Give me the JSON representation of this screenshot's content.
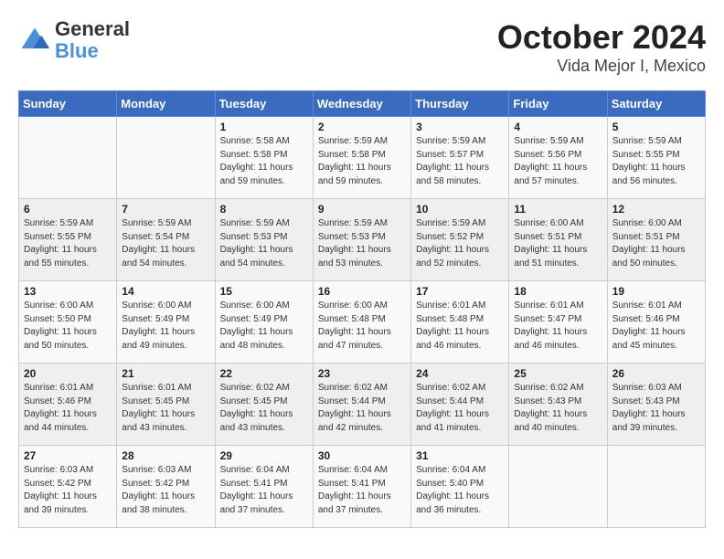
{
  "header": {
    "logo_general": "General",
    "logo_blue": "Blue",
    "title": "October 2024",
    "subtitle": "Vida Mejor I, Mexico"
  },
  "days_of_week": [
    "Sunday",
    "Monday",
    "Tuesday",
    "Wednesday",
    "Thursday",
    "Friday",
    "Saturday"
  ],
  "weeks": [
    [
      {
        "day": "",
        "info": ""
      },
      {
        "day": "",
        "info": ""
      },
      {
        "day": "1",
        "info": "Sunrise: 5:58 AM\nSunset: 5:58 PM\nDaylight: 11 hours and 59 minutes."
      },
      {
        "day": "2",
        "info": "Sunrise: 5:59 AM\nSunset: 5:58 PM\nDaylight: 11 hours and 59 minutes."
      },
      {
        "day": "3",
        "info": "Sunrise: 5:59 AM\nSunset: 5:57 PM\nDaylight: 11 hours and 58 minutes."
      },
      {
        "day": "4",
        "info": "Sunrise: 5:59 AM\nSunset: 5:56 PM\nDaylight: 11 hours and 57 minutes."
      },
      {
        "day": "5",
        "info": "Sunrise: 5:59 AM\nSunset: 5:55 PM\nDaylight: 11 hours and 56 minutes."
      }
    ],
    [
      {
        "day": "6",
        "info": "Sunrise: 5:59 AM\nSunset: 5:55 PM\nDaylight: 11 hours and 55 minutes."
      },
      {
        "day": "7",
        "info": "Sunrise: 5:59 AM\nSunset: 5:54 PM\nDaylight: 11 hours and 54 minutes."
      },
      {
        "day": "8",
        "info": "Sunrise: 5:59 AM\nSunset: 5:53 PM\nDaylight: 11 hours and 54 minutes."
      },
      {
        "day": "9",
        "info": "Sunrise: 5:59 AM\nSunset: 5:53 PM\nDaylight: 11 hours and 53 minutes."
      },
      {
        "day": "10",
        "info": "Sunrise: 5:59 AM\nSunset: 5:52 PM\nDaylight: 11 hours and 52 minutes."
      },
      {
        "day": "11",
        "info": "Sunrise: 6:00 AM\nSunset: 5:51 PM\nDaylight: 11 hours and 51 minutes."
      },
      {
        "day": "12",
        "info": "Sunrise: 6:00 AM\nSunset: 5:51 PM\nDaylight: 11 hours and 50 minutes."
      }
    ],
    [
      {
        "day": "13",
        "info": "Sunrise: 6:00 AM\nSunset: 5:50 PM\nDaylight: 11 hours and 50 minutes."
      },
      {
        "day": "14",
        "info": "Sunrise: 6:00 AM\nSunset: 5:49 PM\nDaylight: 11 hours and 49 minutes."
      },
      {
        "day": "15",
        "info": "Sunrise: 6:00 AM\nSunset: 5:49 PM\nDaylight: 11 hours and 48 minutes."
      },
      {
        "day": "16",
        "info": "Sunrise: 6:00 AM\nSunset: 5:48 PM\nDaylight: 11 hours and 47 minutes."
      },
      {
        "day": "17",
        "info": "Sunrise: 6:01 AM\nSunset: 5:48 PM\nDaylight: 11 hours and 46 minutes."
      },
      {
        "day": "18",
        "info": "Sunrise: 6:01 AM\nSunset: 5:47 PM\nDaylight: 11 hours and 46 minutes."
      },
      {
        "day": "19",
        "info": "Sunrise: 6:01 AM\nSunset: 5:46 PM\nDaylight: 11 hours and 45 minutes."
      }
    ],
    [
      {
        "day": "20",
        "info": "Sunrise: 6:01 AM\nSunset: 5:46 PM\nDaylight: 11 hours and 44 minutes."
      },
      {
        "day": "21",
        "info": "Sunrise: 6:01 AM\nSunset: 5:45 PM\nDaylight: 11 hours and 43 minutes."
      },
      {
        "day": "22",
        "info": "Sunrise: 6:02 AM\nSunset: 5:45 PM\nDaylight: 11 hours and 43 minutes."
      },
      {
        "day": "23",
        "info": "Sunrise: 6:02 AM\nSunset: 5:44 PM\nDaylight: 11 hours and 42 minutes."
      },
      {
        "day": "24",
        "info": "Sunrise: 6:02 AM\nSunset: 5:44 PM\nDaylight: 11 hours and 41 minutes."
      },
      {
        "day": "25",
        "info": "Sunrise: 6:02 AM\nSunset: 5:43 PM\nDaylight: 11 hours and 40 minutes."
      },
      {
        "day": "26",
        "info": "Sunrise: 6:03 AM\nSunset: 5:43 PM\nDaylight: 11 hours and 39 minutes."
      }
    ],
    [
      {
        "day": "27",
        "info": "Sunrise: 6:03 AM\nSunset: 5:42 PM\nDaylight: 11 hours and 39 minutes."
      },
      {
        "day": "28",
        "info": "Sunrise: 6:03 AM\nSunset: 5:42 PM\nDaylight: 11 hours and 38 minutes."
      },
      {
        "day": "29",
        "info": "Sunrise: 6:04 AM\nSunset: 5:41 PM\nDaylight: 11 hours and 37 minutes."
      },
      {
        "day": "30",
        "info": "Sunrise: 6:04 AM\nSunset: 5:41 PM\nDaylight: 11 hours and 37 minutes."
      },
      {
        "day": "31",
        "info": "Sunrise: 6:04 AM\nSunset: 5:40 PM\nDaylight: 11 hours and 36 minutes."
      },
      {
        "day": "",
        "info": ""
      },
      {
        "day": "",
        "info": ""
      }
    ]
  ]
}
